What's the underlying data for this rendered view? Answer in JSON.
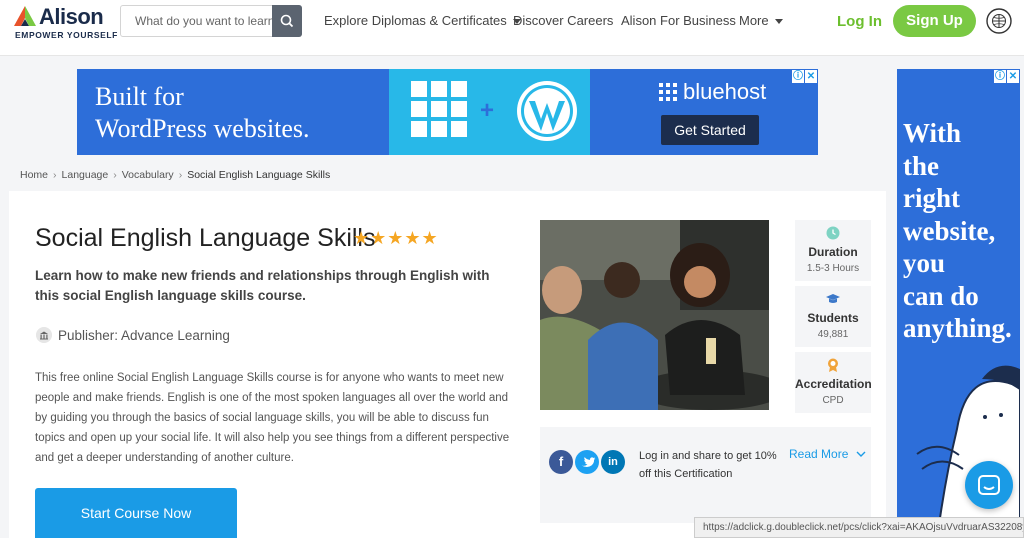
{
  "header": {
    "logo_text": "Alison",
    "logo_tagline": "EMPOWER YOURSELF",
    "search_placeholder": "What do you want to learn?",
    "nav": [
      {
        "label": "Explore Diplomas & Certificates"
      },
      {
        "label": "Discover Careers"
      },
      {
        "label": "Alison For Business"
      },
      {
        "label": "More"
      }
    ],
    "login_label": "Log In",
    "signup_label": "Sign Up"
  },
  "ad_top": {
    "headline_line1": "Built for",
    "headline_line2": "WordPress websites.",
    "plus": "+",
    "brand": "bluehost",
    "cta": "Get Started"
  },
  "ad_side": {
    "text": "With\nthe\nright\nwebsite,\nyou\ncan do\nanything."
  },
  "breadcrumb": [
    "Home",
    "Language",
    "Vocabulary",
    "Social English Language Skills"
  ],
  "course": {
    "title": "Social English Language Skills",
    "stars": "★★★★★",
    "subtitle": "Learn how to make new friends and relationships through English with this social English language skills course.",
    "publisher": "Publisher: Advance Learning",
    "description": "This free online Social English Language Skills course is for anyone who wants to meet new people and make friends. English is one of the most spoken languages all over the world and by guiding you through the basics of social language skills, you will be able to discuss fun topics and open up your social life. It will also help you see things from a different perspective and get a deeper understanding of another culture.",
    "start_label": "Start Course Now"
  },
  "stats": [
    {
      "label": "Duration",
      "value": "1.5-3 Hours"
    },
    {
      "label": "Students",
      "value": "49,881"
    },
    {
      "label": "Accreditation",
      "value": "CPD"
    }
  ],
  "share": {
    "facebook": "f",
    "linkedin": "in",
    "text": "Log in and share to get 10% off this Certification",
    "read_more": "Read More"
  },
  "status_url": "https://adclick.g.doubleclick.net/pcs/click?xai=AKAOjsuVvdruarAS32208y5VimL",
  "colors": {
    "brand_green": "#7ac943",
    "accent_blue": "#1a9be6",
    "ad_blue": "#2d6ed9",
    "star_orange": "#f5a623"
  }
}
